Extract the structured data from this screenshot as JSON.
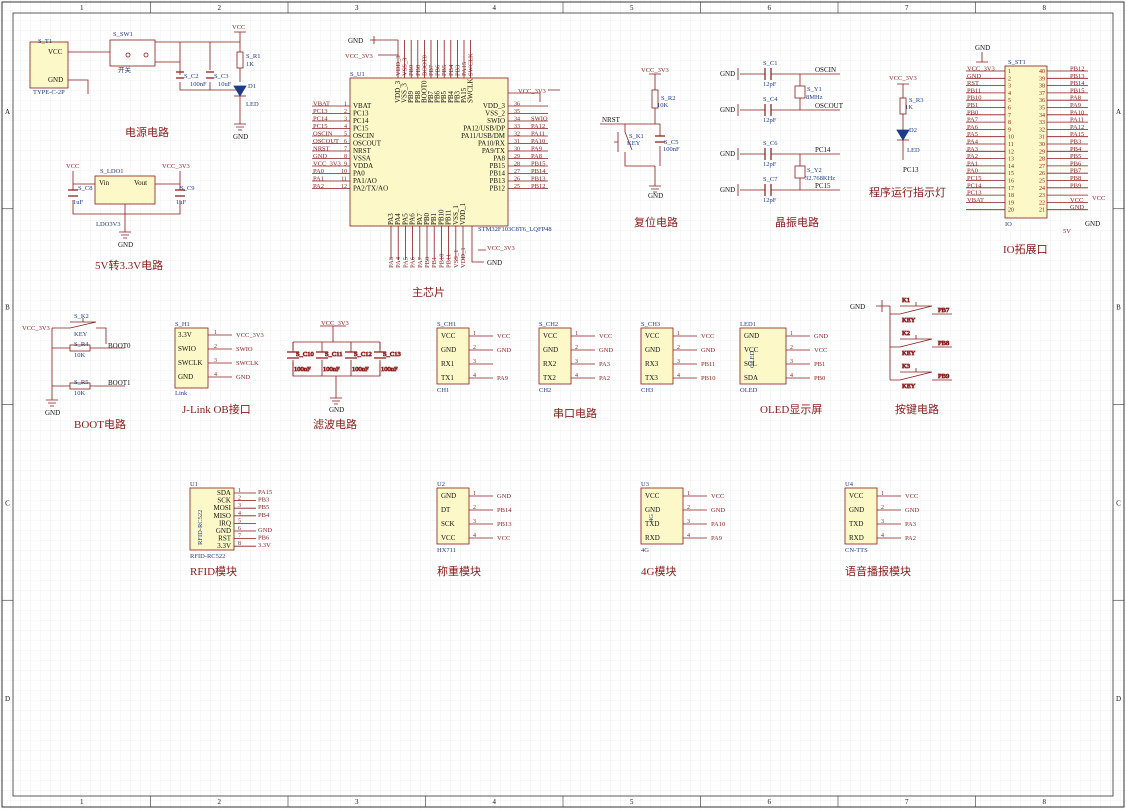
{
  "frame": {
    "columns": [
      "1",
      "2",
      "3",
      "4",
      "5",
      "6",
      "7",
      "8"
    ],
    "rows": [
      "A",
      "B",
      "C",
      "D"
    ]
  },
  "sections": {
    "power": "电源电路",
    "ldo": "5V转3.3V电路",
    "mcu": "主芯片",
    "reset": "复位电路",
    "crystal": "晶振电路",
    "indicator": "程序运行指示灯",
    "io": "IO拓展口",
    "boot": "BOOT电路",
    "jlink": "J-Link OB接口",
    "filter": "滤波电路",
    "uart": "串口电路",
    "oled": "OLED显示屏",
    "keys": "按键电路",
    "rfid": "RFID模块",
    "weigh": "称重模块",
    "g4": "4G模块",
    "voice": "语音播报模块"
  },
  "power": {
    "t1_ref": "S_T1",
    "t1_value": "TYPE-C-2P",
    "t1_pins": [
      "VCC",
      "GND",
      "NC",
      "NC"
    ],
    "sw_ref": "S_SW1",
    "sw_value": "开关",
    "c2_ref": "S_C2",
    "c2_value": "100nF",
    "c3_ref": "S_C3",
    "c3_value": "10uF",
    "r1_ref": "S_R1",
    "r1_value": "1K",
    "d1_ref": "D1",
    "d1_value": "LED",
    "vcc": "VCC",
    "gnd": "GND"
  },
  "ldo": {
    "ref": "S_LDO1",
    "value": "LDO3V3",
    "pins": [
      "Vin",
      "Vout",
      "GND"
    ],
    "c8_ref": "S_C8",
    "c8_value": "1uF",
    "c9_ref": "S_C9",
    "c9_value": "1uF",
    "vcc": "VCC",
    "vcc33": "VCC_3V3",
    "gnd": "GND"
  },
  "mcu": {
    "ref": "S_U1",
    "value": "STM32F103C8T6_LQFP48",
    "left_pins": [
      {
        "num": "1",
        "name": "VBAT",
        "net": "VBAT"
      },
      {
        "num": "2",
        "name": "PC13",
        "net": "PC13"
      },
      {
        "num": "3",
        "name": "PC14",
        "net": "PC14"
      },
      {
        "num": "4",
        "name": "PC15",
        "net": "PC15"
      },
      {
        "num": "5",
        "name": "OSCIN",
        "net": "OSCIN"
      },
      {
        "num": "6",
        "name": "OSCOUT",
        "net": "OSCOUT"
      },
      {
        "num": "7",
        "name": "NRST",
        "net": "NRST"
      },
      {
        "num": "8",
        "name": "VSSA",
        "net": "GND"
      },
      {
        "num": "9",
        "name": "VDDA",
        "net": "VCC_3V3"
      },
      {
        "num": "10",
        "name": "PA0",
        "net": "PA0"
      },
      {
        "num": "11",
        "name": "PA1/AO",
        "net": "PA1"
      },
      {
        "num": "12",
        "name": "PA2/TX/AO",
        "net": "PA2"
      }
    ],
    "right_pins": [
      {
        "num": "36",
        "name": "VDD_3",
        "net": ""
      },
      {
        "num": "35",
        "name": "VSS_2",
        "net": ""
      },
      {
        "num": "34",
        "name": "SWIO",
        "net": "SWIO"
      },
      {
        "num": "33",
        "name": "PA12/USB/DP",
        "net": "PA12"
      },
      {
        "num": "32",
        "name": "PA11/USB/DM",
        "net": "PA11"
      },
      {
        "num": "31",
        "name": "PA10/RX",
        "net": "PA10"
      },
      {
        "num": "30",
        "name": "PA9/TX",
        "net": "PA9"
      },
      {
        "num": "29",
        "name": "PA8",
        "net": "PA8"
      },
      {
        "num": "28",
        "name": "PB15",
        "net": "PB15"
      },
      {
        "num": "27",
        "name": "PB14",
        "net": "PB14"
      },
      {
        "num": "26",
        "name": "PB13",
        "net": "PB13"
      },
      {
        "num": "25",
        "name": "PB12",
        "net": "PB12"
      }
    ],
    "top_pins": [
      "VDD_3",
      "VSS_3",
      "PB9",
      "PB8",
      "BOOT0",
      "PB7",
      "PB6",
      "PB5",
      "PB4",
      "PB3",
      "PA15",
      "SWCLK"
    ],
    "bottom_pins": [
      "PA3",
      "PA4",
      "PA5",
      "PA6",
      "PA7",
      "PB0",
      "PB1",
      "PB10",
      "PB11",
      "VSS_1",
      "VDD_1"
    ],
    "nets_top": [
      "GND",
      "VCC_3V3",
      "VCC_3V3"
    ],
    "net_bottom_vcc": "VCC_3V3",
    "net_bottom_gnd": "GND"
  },
  "reset": {
    "vcc": "VCC_3V3",
    "r2_ref": "S_R2",
    "r2_value": "10K",
    "k1_ref": "S_K1",
    "k1_value": "KEY",
    "c5_ref": "S_C5",
    "c5_value": "100nF",
    "net": "NRST",
    "gnd": "GND"
  },
  "crystal": {
    "c1_ref": "S_C1",
    "c1_value": "12pF",
    "c4_ref": "S_C4",
    "c4_value": "12pF",
    "c6_ref": "S_C6",
    "c6_value": "12pF",
    "c7_ref": "S_C7",
    "c7_value": "12pF",
    "y1_ref": "S_Y1",
    "y1_value": "8MHz",
    "y2_ref": "S_Y2",
    "y2_value": "32.768KHz",
    "nets": [
      "OSCIN",
      "OSCOUT",
      "PC14",
      "PC15"
    ],
    "gnd": "GND"
  },
  "indicator": {
    "vcc": "VCC_3V3",
    "r3_ref": "S_R3",
    "r3_value": "1K",
    "d2_ref": "D2",
    "d2_value": "LED",
    "net": "PC13"
  },
  "io": {
    "ref": "S_ST1",
    "value": "IO",
    "gnd": "GND",
    "vcc33": "VCC_3V3",
    "vcc": "VCC",
    "v5": "5V",
    "left_nets": [
      "VCC_3V3",
      "GND",
      "RST",
      "PB11",
      "PB10",
      "PB1",
      "PB0",
      "PA7",
      "PA6",
      "PA5",
      "PA4",
      "PA3",
      "PA2",
      "PA1",
      "PA0",
      "PC15",
      "PC14",
      "PC13",
      "VBAT",
      ""
    ],
    "right_nets": [
      "PB12",
      "PB13",
      "PB14",
      "PB15",
      "PA8",
      "PA9",
      "PA10",
      "PA11",
      "PA12",
      "PA15",
      "PB3",
      "PB4",
      "PB5",
      "PB6",
      "PB7",
      "PB8",
      "PB9",
      "",
      "VCC",
      "GND"
    ]
  },
  "boot": {
    "vcc": "VCC_3V3",
    "k2_ref": "S_K2",
    "k2_value": "KEY",
    "r4_ref": "S_R4",
    "r4_value": "10K",
    "r5_ref": "S_R5",
    "r5_value": "10K",
    "nets": [
      "BOOT0",
      "BOOT1"
    ],
    "gnd": "GND"
  },
  "jlink": {
    "ref": "S_H1",
    "value": "Link",
    "pins": [
      "3.3V",
      "SWIO",
      "SWCLK",
      "GND"
    ],
    "nets": [
      "VCC_3V3",
      "SWIO",
      "SWCLK",
      "GND"
    ]
  },
  "filter": {
    "vcc": "VCC_3V3",
    "gnd": "GND",
    "caps": [
      {
        "ref": "S_C10",
        "value": "100nF"
      },
      {
        "ref": "S_C11",
        "value": "100nF"
      },
      {
        "ref": "S_C12",
        "value": "100nF"
      },
      {
        "ref": "S_C13",
        "value": "100nF"
      }
    ]
  },
  "uart": [
    {
      "ref": "S_CH1",
      "value": "CH1",
      "pins": [
        "VCC",
        "GND",
        "RX1",
        "TX1"
      ],
      "nets": [
        "VCC",
        "GND",
        "",
        "PA9"
      ]
    },
    {
      "ref": "S_CH2",
      "value": "CH2",
      "pins": [
        "VCC",
        "GND",
        "RX2",
        "TX2"
      ],
      "nets": [
        "VCC",
        "GND",
        "PA3",
        "PA2"
      ]
    },
    {
      "ref": "S_CH3",
      "value": "CH3",
      "pins": [
        "VCC",
        "GND",
        "RX3",
        "TX3"
      ],
      "nets": [
        "VCC",
        "GND",
        "PB11",
        "PB10"
      ]
    }
  ],
  "oled": {
    "ref": "LED1",
    "value": "OLED",
    "pins": [
      "GND",
      "VCC",
      "SCL",
      "SDA"
    ],
    "nets": [
      "GND",
      "VCC",
      "PB1",
      "PB0"
    ]
  },
  "keys": {
    "gnd": "GND",
    "items": [
      {
        "ref": "K1",
        "value": "KEY",
        "net": "PB7"
      },
      {
        "ref": "K2",
        "value": "KEY",
        "net": "PB8"
      },
      {
        "ref": "K3",
        "value": "KEY",
        "net": "PB9"
      }
    ]
  },
  "rfid": {
    "ref": "U1",
    "value": "RFID-RC522",
    "body": "RFID-RC522",
    "pins": [
      "SDA",
      "SCK",
      "MOSI",
      "MISO",
      "IRQ",
      "GND",
      "RST",
      "3.3V"
    ],
    "nets": [
      "PA15",
      "PB3",
      "PB5",
      "PB4",
      "",
      "GND",
      "PB6",
      "3.3V"
    ]
  },
  "weigh": {
    "ref": "U2",
    "value": "HX711",
    "pins": [
      "GND",
      "DT",
      "SCK",
      "VCC"
    ],
    "nets": [
      "GND",
      "PB14",
      "PB13",
      "VCC"
    ]
  },
  "g4": {
    "ref": "U3",
    "value": "4G",
    "body": "4G",
    "pins": [
      "VCC",
      "GND",
      "TXD",
      "RXD"
    ],
    "nets": [
      "VCC",
      "GND",
      "PA10",
      "PA9"
    ]
  },
  "voice": {
    "ref": "U4",
    "value": "CN-TTS",
    "pins": [
      "VCC",
      "GND",
      "TXD",
      "RXD"
    ],
    "nets": [
      "VCC",
      "GND",
      "PA3",
      "PA2"
    ]
  }
}
